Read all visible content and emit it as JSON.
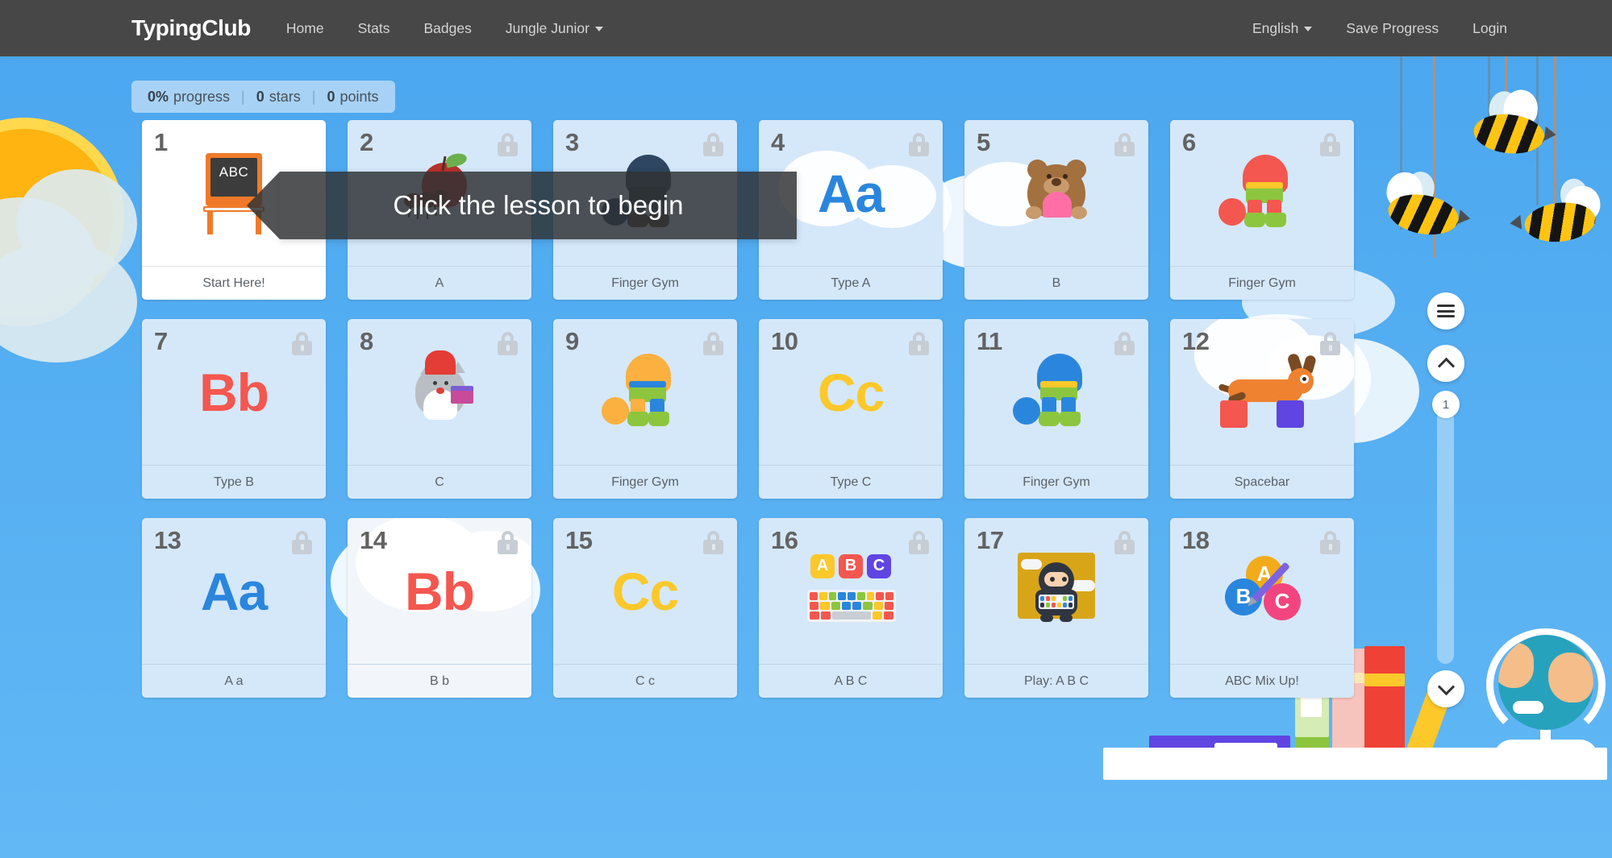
{
  "nav": {
    "brand": "TypingClub",
    "left_items": [
      {
        "label": "Home",
        "icon": ""
      },
      {
        "label": "Stats",
        "icon": ""
      },
      {
        "label": "Badges",
        "icon": ""
      },
      {
        "label": "Jungle Junior",
        "icon": "chevron-down-icon"
      }
    ],
    "right_items": [
      {
        "label": "English",
        "icon": "chevron-down-icon"
      },
      {
        "label": "Save Progress",
        "icon": ""
      },
      {
        "label": "Login",
        "icon": ""
      }
    ]
  },
  "progress": {
    "percent": "0%",
    "percent_label": "progress",
    "stars": "0",
    "stars_label": "stars",
    "points": "0",
    "points_label": "points",
    "separator": "|"
  },
  "tooltip": {
    "text": "Click the lesson to begin"
  },
  "lessons": [
    {
      "num": "1",
      "label": "Start Here!",
      "locked": false,
      "art": "chalkboard-icon"
    },
    {
      "num": "2",
      "label": "A",
      "locked": true,
      "art": "apple-ant-icon"
    },
    {
      "num": "3",
      "label": "Finger Gym",
      "locked": true,
      "art": "finger-gym-navy-icon"
    },
    {
      "num": "4",
      "label": "Type A",
      "locked": true,
      "art": "letter-Aa-blue"
    },
    {
      "num": "5",
      "label": "B",
      "locked": true,
      "art": "bear-icon"
    },
    {
      "num": "6",
      "label": "Finger Gym",
      "locked": true,
      "art": "finger-gym-red-icon"
    },
    {
      "num": "7",
      "label": "Type B",
      "locked": true,
      "art": "letter-Bb-red"
    },
    {
      "num": "8",
      "label": "C",
      "locked": true,
      "art": "cat-chef-icon"
    },
    {
      "num": "9",
      "label": "Finger Gym",
      "locked": true,
      "art": "finger-gym-orange-icon"
    },
    {
      "num": "10",
      "label": "Type C",
      "locked": true,
      "art": "letter-Cc-yellow"
    },
    {
      "num": "11",
      "label": "Finger Gym",
      "locked": true,
      "art": "finger-gym-blue-icon"
    },
    {
      "num": "12",
      "label": "Spacebar",
      "locked": true,
      "art": "dachshund-blocks-icon"
    },
    {
      "num": "13",
      "label": "A a",
      "locked": true,
      "art": "letter-Aa-blue"
    },
    {
      "num": "14",
      "label": "B b",
      "locked": true,
      "art": "letter-Bb-red"
    },
    {
      "num": "15",
      "label": "C c",
      "locked": true,
      "art": "letter-Cc-yellow"
    },
    {
      "num": "16",
      "label": "A B C",
      "locked": true,
      "art": "abc-blocks-keyboard-icon"
    },
    {
      "num": "17",
      "label": "Play: A B C",
      "locked": true,
      "art": "ninja-keyboard-icon"
    },
    {
      "num": "18",
      "label": "ABC Mix Up!",
      "locked": true,
      "art": "abc-circles-pencil-icon"
    }
  ],
  "letters": {
    "Aa": "Aa",
    "Bb": "Bb",
    "Cc": "Cc",
    "A": "A",
    "B": "B",
    "C": "C",
    "abc_board": "ABC"
  },
  "side_controls": {
    "menu_icon": "hamburger-menu-icon",
    "scroll_up_icon": "chevron-up-icon",
    "scroll_down_icon": "chevron-down-icon",
    "page_number": "1"
  },
  "colors": {
    "sky": "#4ba7f0",
    "nav_bg": "#474747",
    "tile_bg": "#d5e8fa",
    "tile_active_bg": "#ffffff",
    "progress_pill_bg": "#a7d2f6",
    "letter_blue": "#2a86dd",
    "letter_red": "#f4574f",
    "letter_yellow": "#fcc82a",
    "tooltip_bg": "rgba(48,50,53,0.84)",
    "lock_grey": "#c7cdd4"
  }
}
